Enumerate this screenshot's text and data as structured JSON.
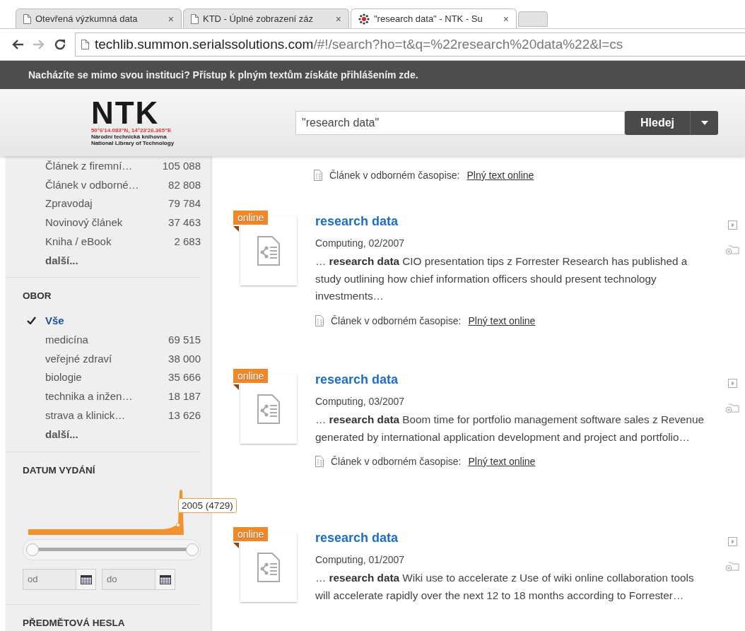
{
  "browser": {
    "tabs": [
      {
        "title": "Otevřená výzkumná data",
        "close": "×",
        "selected": false,
        "kind": "page"
      },
      {
        "title": "KTD - Úplné zobrazení záz",
        "close": "×",
        "selected": false,
        "kind": "page"
      },
      {
        "title": "\"research data\" - NTK - Su",
        "close": "×",
        "selected": true,
        "kind": "site"
      }
    ],
    "url_host": "techlib.summon.serialssolutions.com",
    "url_path": "/#!/search?ho=t&q=%22research%20data%22&l=cs"
  },
  "banner": "Nacházíte se mimo svou instituci? Přístup k plným textům získáte přihlášením zde.",
  "logo": {
    "name": "NTK",
    "coords": "50°6'14.083\"N, 14°23'26.365\"E",
    "line1": "Národní technická knihovna",
    "line2": "National Library of Technology"
  },
  "search": {
    "value": "\"research data\"",
    "button": "Hledej"
  },
  "sidebar": {
    "content_type": {
      "items": [
        {
          "label": "Článek z firemní…",
          "count": "105 088"
        },
        {
          "label": "Článek v odborné…",
          "count": "82 808"
        },
        {
          "label": "Zpravodaj",
          "count": "79 784"
        },
        {
          "label": "Novinový článek",
          "count": "37 463"
        },
        {
          "label": "Kniha / eBook",
          "count": "2 683"
        }
      ],
      "more": "další..."
    },
    "field": {
      "title": "OBOR",
      "items": [
        {
          "label": "Vše",
          "selected": true
        },
        {
          "label": "medicína",
          "count": "69 515",
          "selected": false
        },
        {
          "label": "veřejné zdraví",
          "count": "38 000",
          "selected": false
        },
        {
          "label": "biologie",
          "count": "35 666",
          "selected": false
        },
        {
          "label": "technika a inžen…",
          "count": "18 187",
          "selected": false
        },
        {
          "label": "strava a klinick…",
          "count": "13 626",
          "selected": false
        }
      ],
      "more": "další..."
    },
    "date": {
      "title": "DATUM VYDÁNÍ",
      "tooltip": "2005 (4729)",
      "slider": {
        "start": {
          "level": 0
        },
        "end": {
          "level": 1
        }
      },
      "from": {
        "placeholder": "od"
      },
      "to": {
        "placeholder": "do"
      }
    },
    "subjects": {
      "title": "PŘEDMĚTOVÁ HESLA"
    }
  },
  "partial_result": {
    "format": "Článek v odborném časopise:",
    "link": "Plný text online"
  },
  "results": [
    {
      "badge": "online",
      "title": "research data",
      "source": "Computing, 02/2007",
      "snippet": "…  **research data** CIO presentation tips z Forrester Research has published a study outlining how chief information officers should present technology investments…",
      "format": "Článek v odborném časopise:",
      "link": "Plný text online"
    },
    {
      "badge": "online",
      "title": "research data",
      "source": "Computing, 03/2007",
      "snippet": "…  **research data** Boom time for portfolio management software sales z Revenue generated by international application development and project and portfolio…",
      "format": "Článek v odborném časopise:",
      "link": "Plný text online"
    },
    {
      "badge": "online",
      "title": "research data",
      "source": "Computing, 01/2007",
      "snippet": "…  **research data** Wiki use to accelerate z Use of wiki online collaboration tools will accelerate rapidly over the next 12 to 18 months according to Forrester…"
    }
  ]
}
